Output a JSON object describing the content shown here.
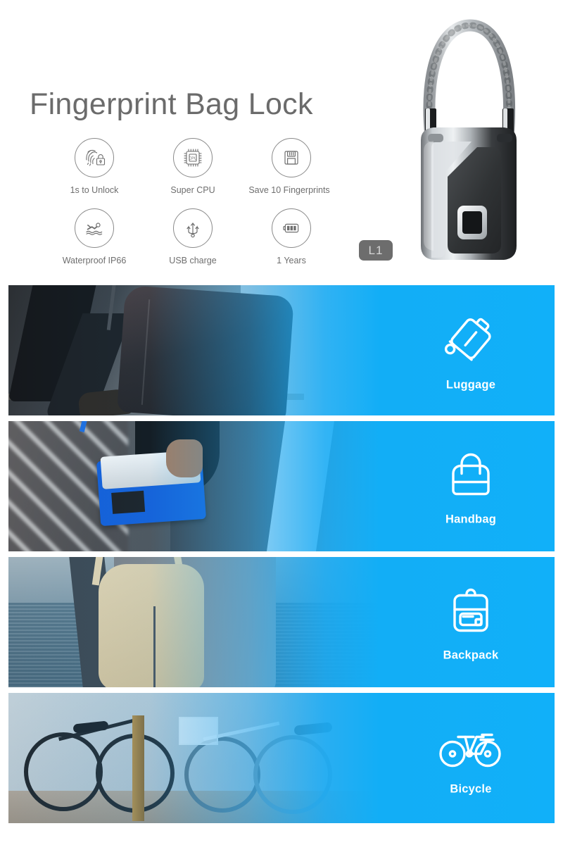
{
  "hero": {
    "title": "Fingerprint Bag Lock",
    "model_badge": "L1",
    "product_name": "fingerprint-padlock",
    "features": [
      {
        "icon": "fingerprint-lock-icon",
        "label": "1s to Unlock"
      },
      {
        "icon": "cpu-chip-icon",
        "label": "Super CPU",
        "chip_text": "CPU"
      },
      {
        "icon": "floppy-save-icon",
        "label": "Save 10 Fingerprints"
      },
      {
        "icon": "swimmer-waterproof-icon",
        "label": "Waterproof IP66"
      },
      {
        "icon": "usb-icon",
        "label": "USB charge"
      },
      {
        "icon": "battery-icon",
        "label": "1 Years"
      }
    ]
  },
  "banners": [
    {
      "label": "Luggage",
      "icon": "rolling-luggage-icon",
      "scene": "person-pulling-rolling-suitcase"
    },
    {
      "label": "Handbag",
      "icon": "handbag-icon",
      "scene": "person-holding-blue-white-handbag"
    },
    {
      "label": "Backpack",
      "icon": "backpack-icon",
      "scene": "person-wearing-beige-backpack-by-water"
    },
    {
      "label": "Bicycle",
      "icon": "bicycle-icon",
      "scene": "bicycles-parked-on-sidewalk"
    }
  ],
  "colors": {
    "accent_blue_right": "#11b0f9",
    "accent_blue_left": "#1eaaf5",
    "title_gray": "#6b6b6b",
    "label_gray": "#6e6e6e",
    "badge_bg": "#6d6d6d",
    "badge_text": "#d6d6d6"
  }
}
